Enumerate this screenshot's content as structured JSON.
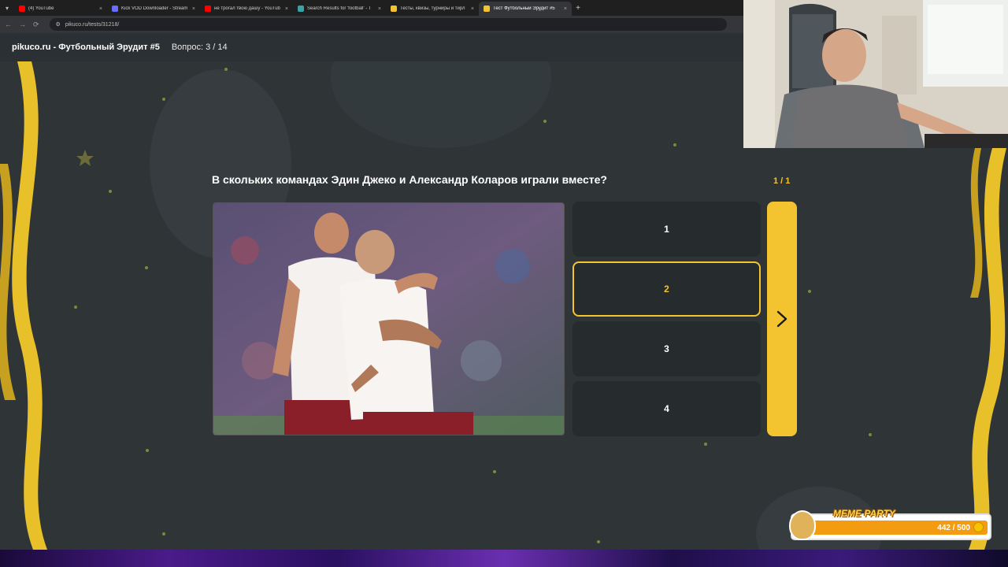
{
  "browser": {
    "tabs": [
      {
        "title": "(4) YouTube",
        "color": "#ff0000",
        "active": false
      },
      {
        "title": "Kick VOD Downloader - Stream",
        "color": "#6b6bff",
        "active": false
      },
      {
        "title": "не трогал твою дашу - YouTub",
        "color": "#ff0000",
        "active": false
      },
      {
        "title": "Search Results for 'football' - T",
        "color": "#3aa3a3",
        "active": false
      },
      {
        "title": "Тесты, квизы, турниры и тирл",
        "color": "#f4c430",
        "active": false
      },
      {
        "title": "Тест Футбольный Эрудит #5",
        "color": "#f4c430",
        "active": true
      }
    ],
    "url": "pikuco.ru/tests/31218/"
  },
  "site": {
    "title": "pikuco.ru - Футбольный Эрудит #5",
    "counter": "Вопрос: 3 / 14"
  },
  "quiz": {
    "question": "В скольких командах Эдин Джеко и Александр Коларов играли вместе?",
    "page_indicator": "1 / 1",
    "answers": [
      {
        "label": "1",
        "selected": false
      },
      {
        "label": "2",
        "selected": true
      },
      {
        "label": "3",
        "selected": false
      },
      {
        "label": "4",
        "selected": false
      }
    ],
    "accent_color": "#f4c430"
  },
  "overlay": {
    "widget_title": "MEME PARTY",
    "progress_text": "442 / 500",
    "progress": 0.884
  }
}
